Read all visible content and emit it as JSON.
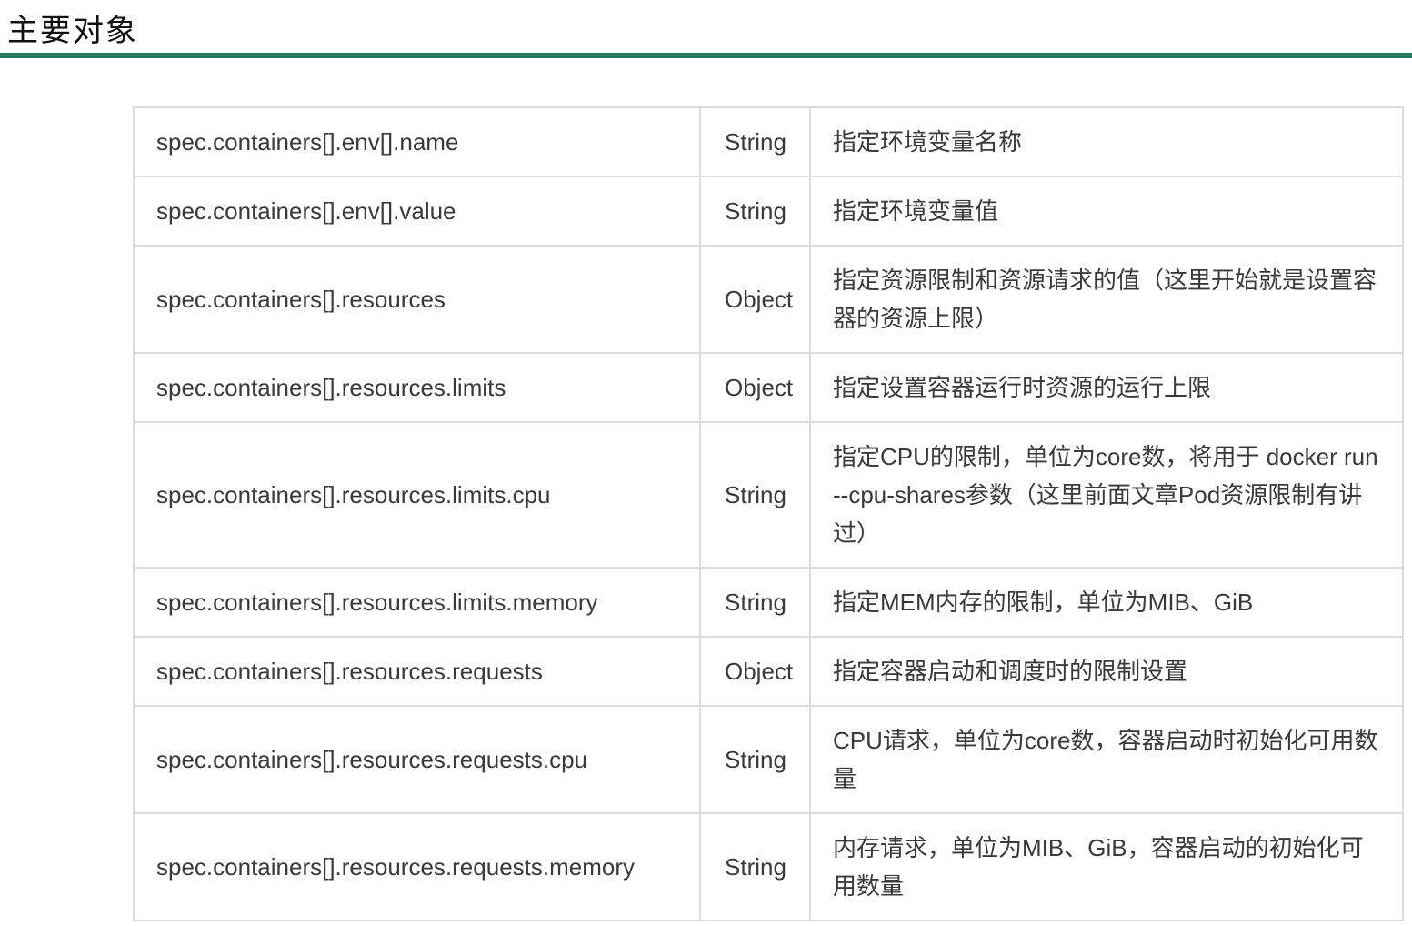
{
  "header": {
    "title": "主要对象"
  },
  "table": {
    "rows": [
      {
        "field": "spec.containers[].env[].name",
        "type": "String",
        "desc": "指定环境变量名称"
      },
      {
        "field": "spec.containers[].env[].value",
        "type": "String",
        "desc": "指定环境变量值"
      },
      {
        "field": "spec.containers[].resources",
        "type": "Object",
        "desc": "指定资源限制和资源请求的值（这里开始就是设置容器的资源上限）"
      },
      {
        "field": "spec.containers[].resources.limits",
        "type": "Object",
        "desc": "指定设置容器运行时资源的运行上限"
      },
      {
        "field": "spec.containers[].resources.limits.cpu",
        "type": "String",
        "desc": "指定CPU的限制，单位为core数，将用于 docker run --cpu-shares参数（这里前面文章Pod资源限制有讲过）"
      },
      {
        "field": "spec.containers[].resources.limits.memory",
        "type": "String",
        "desc": "指定MEM内存的限制，单位为MIB、GiB"
      },
      {
        "field": "spec.containers[].resources.requests",
        "type": "Object",
        "desc": "指定容器启动和调度时的限制设置"
      },
      {
        "field": "spec.containers[].resources.requests.cpu",
        "type": "String",
        "desc": "CPU请求，单位为core数，容器启动时初始化可用数量"
      },
      {
        "field": "spec.containers[].resources.requests.memory",
        "type": "String",
        "desc": "内存请求，单位为MIB、GiB，容器启动的初始化可用数量"
      }
    ]
  },
  "colors": {
    "rule": "#1f7a5e",
    "border": "#dcdcdc",
    "text": "#3a3a3a"
  }
}
